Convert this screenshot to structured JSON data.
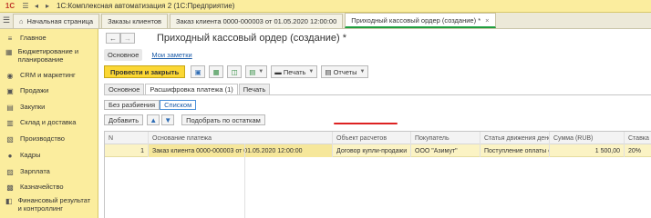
{
  "app": {
    "logo": "1С",
    "title": "1С:Комплексная автоматизация 2  (1С:Предприятие)"
  },
  "window_tabs": [
    {
      "label": "Начальная страница"
    },
    {
      "label": "Заказы клиентов"
    },
    {
      "label": "Заказ клиента 0000-000003 от 01.05.2020 12:00:00"
    },
    {
      "label": "Приходный кассовый ордер (создание) *"
    }
  ],
  "sidebar": {
    "items": [
      {
        "label": "Главное"
      },
      {
        "label": "Бюджетирование и планирование"
      },
      {
        "label": "CRM и маркетинг"
      },
      {
        "label": "Продажи"
      },
      {
        "label": "Закупки"
      },
      {
        "label": "Склад и доставка"
      },
      {
        "label": "Производство"
      },
      {
        "label": "Кадры"
      },
      {
        "label": "Зарплата"
      },
      {
        "label": "Казначейство"
      },
      {
        "label": "Финансовый результат и контроллинг"
      }
    ]
  },
  "document": {
    "title": "Приходный кассовый ордер (создание) *",
    "subnav": {
      "main": "Основное",
      "notes": "Мои заметки"
    }
  },
  "toolbar": {
    "post_close": "Провести и закрыть",
    "print": "Печать",
    "reports": "Отчеты"
  },
  "doc_tabs": [
    {
      "label": "Основное"
    },
    {
      "label": "Расшифровка платежа (1)"
    },
    {
      "label": "Печать"
    }
  ],
  "toggles": {
    "no_split": "Без разбиения",
    "list": "Списком"
  },
  "row_buttons": {
    "add": "Добавить",
    "pick": "Подобрать по остаткам"
  },
  "table": {
    "headers": {
      "n": "N",
      "base": "Основание платежа",
      "object": "Объект расчетов",
      "buyer": "Покупатель",
      "article": "Статья движения дене...",
      "sum": "Сумма (RUB)",
      "rate": "Ставка"
    },
    "rows": [
      {
        "n": "1",
        "base": "Заказ клиента 0000-000003 от 01.05.2020 12:00:00",
        "object": "Договор купли-продажи",
        "buyer": "ООО \"Азимут\"",
        "article": "Поступление оплаты о...",
        "sum": "1 500,00",
        "rate": "20%"
      }
    ]
  },
  "colors": {
    "accent_yellow": "#fbd735",
    "sidebar_bg": "#fbed9e",
    "active_tab_underline": "#1e9e3e",
    "highlight_red": "#dd2222"
  }
}
